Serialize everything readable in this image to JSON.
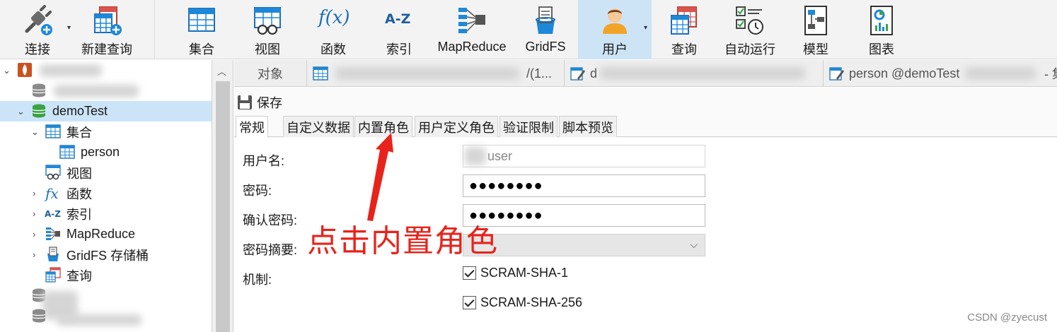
{
  "toolbar": {
    "buttons": [
      {
        "label": "连接",
        "icon": "plug-icon"
      },
      {
        "label": "新建查询",
        "icon": "new-query-icon"
      },
      {
        "label": "集合",
        "icon": "table-icon"
      },
      {
        "label": "视图",
        "icon": "view-icon"
      },
      {
        "label": "函数",
        "icon": "function-icon",
        "glyph": "f(x)"
      },
      {
        "label": "索引",
        "icon": "index-icon",
        "glyph": "A-Z"
      },
      {
        "label": "MapReduce",
        "icon": "mapreduce-icon"
      },
      {
        "label": "GridFS",
        "icon": "gridfs-icon"
      },
      {
        "label": "用户",
        "icon": "user-icon",
        "active": true
      },
      {
        "label": "查询",
        "icon": "query-icon"
      },
      {
        "label": "自动运行",
        "icon": "automation-icon"
      },
      {
        "label": "模型",
        "icon": "model-icon"
      },
      {
        "label": "图表",
        "icon": "chart-icon"
      }
    ]
  },
  "nav": {
    "items": [
      {
        "label": "demoTest",
        "icon": "database-icon",
        "selected": true
      },
      {
        "label": "集合",
        "icon": "table-icon"
      },
      {
        "label": "person",
        "icon": "table-icon"
      },
      {
        "label": "视图",
        "icon": "view-icon"
      },
      {
        "label": "函数",
        "icon": "function-icon",
        "glyph": "fx"
      },
      {
        "label": "索引",
        "icon": "index-icon",
        "glyph": "A-Z"
      },
      {
        "label": "MapReduce",
        "icon": "mapreduce-icon"
      },
      {
        "label": "GridFS 存储桶",
        "icon": "gridfs-icon"
      },
      {
        "label": "查询",
        "icon": "query-icon"
      }
    ]
  },
  "doctabs": {
    "objects_label": "对象",
    "tab1_suffix": "/(1...",
    "tab2_prefix": "d",
    "tab3_label": "person @demoTest",
    "tab3_suffix": "- 集"
  },
  "editor": {
    "save_label": "保存",
    "tabs": [
      "常规",
      "自定义数据",
      "内置角色",
      "用户定义角色",
      "验证限制",
      "脚本预览"
    ],
    "active_tab": "常规",
    "form": {
      "username_label": "用户名:",
      "username_value": "user",
      "password_label": "密码:",
      "password_value": "●●●●●●●●",
      "confirm_label": "确认密码:",
      "confirm_value": "●●●●●●●●",
      "digest_label": "密码摘要:",
      "mechanism_label": "机制:",
      "mechanisms": [
        {
          "label": "SCRAM-SHA-1",
          "checked": true
        },
        {
          "label": "SCRAM-SHA-256",
          "checked": true
        }
      ]
    }
  },
  "annotation": {
    "text": "点击内置角色",
    "color": "#e8231b"
  },
  "watermark": "CSDN @zyecust",
  "colors": {
    "accent": "#1e88d8",
    "selection": "#cce4f7",
    "db_green": "#3aa346"
  }
}
